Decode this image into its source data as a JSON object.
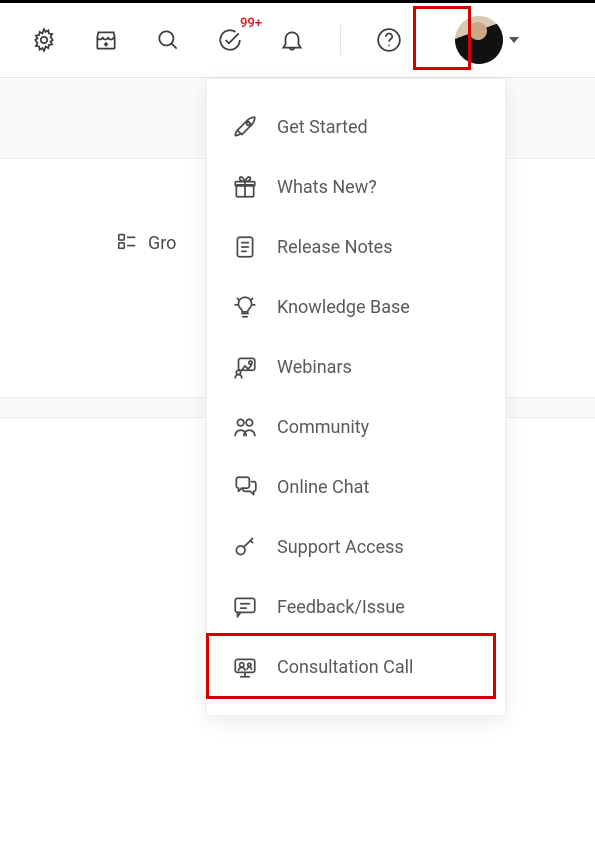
{
  "topbar": {
    "tasks_badge": "99+"
  },
  "group_by_label": "Gro",
  "help_menu": {
    "items": [
      {
        "icon": "rocket-icon",
        "label": "Get Started"
      },
      {
        "icon": "gift-icon",
        "label": "Whats New?"
      },
      {
        "icon": "document-icon",
        "label": "Release Notes"
      },
      {
        "icon": "lightbulb-icon",
        "label": "Knowledge Base"
      },
      {
        "icon": "webinar-icon",
        "label": "Webinars"
      },
      {
        "icon": "community-icon",
        "label": "Community"
      },
      {
        "icon": "chat-icon",
        "label": "Online Chat"
      },
      {
        "icon": "key-icon",
        "label": "Support Access"
      },
      {
        "icon": "feedback-icon",
        "label": "Feedback/Issue"
      },
      {
        "icon": "consultation-icon",
        "label": "Consultation Call"
      }
    ]
  },
  "highlights": {
    "help_button": true,
    "feedback_item": true
  }
}
